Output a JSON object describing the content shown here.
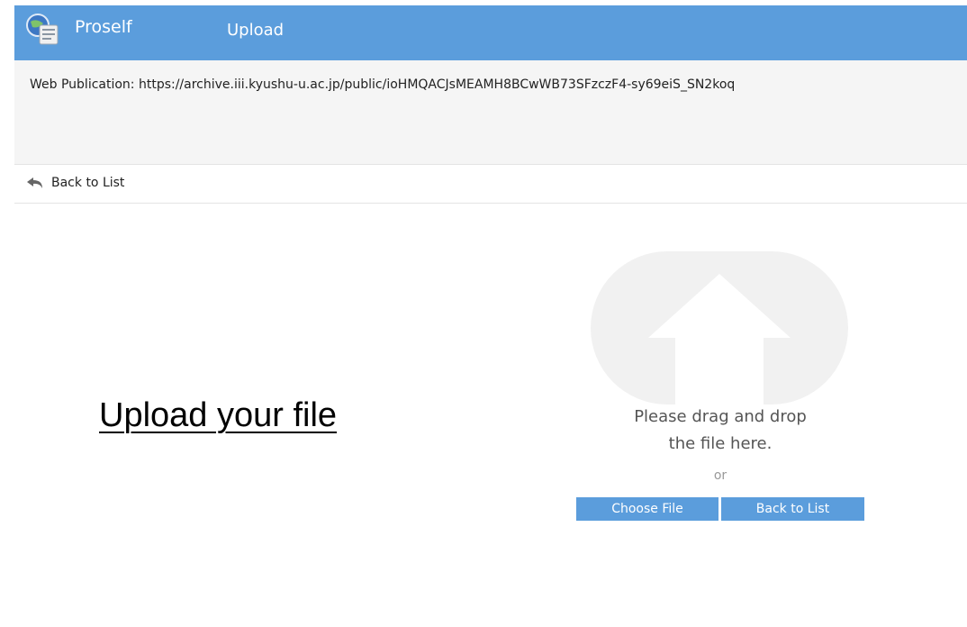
{
  "header": {
    "app_name": "Proself",
    "page_name": "Upload",
    "logo_icon": "proself-logo-icon",
    "background_color": "#5b9ddc"
  },
  "publication": {
    "text": "Web Publication: https://archive.iii.kyushu-u.ac.jp/public/ioHMQACJsMEAMH8BCwWB73SFzczF4-sy69eiS_SN2koq"
  },
  "nav": {
    "back_icon": "undo-arrow-icon",
    "back_label": "Back to List"
  },
  "main": {
    "heading": "Upload your file"
  },
  "dropzone": {
    "icon": "cloud-upload-icon",
    "line1": "Please drag and drop",
    "line2": "the file here.",
    "or_text": "or",
    "choose_label": "Choose File",
    "back_label": "Back to List",
    "button_color": "#5b9ddc"
  }
}
